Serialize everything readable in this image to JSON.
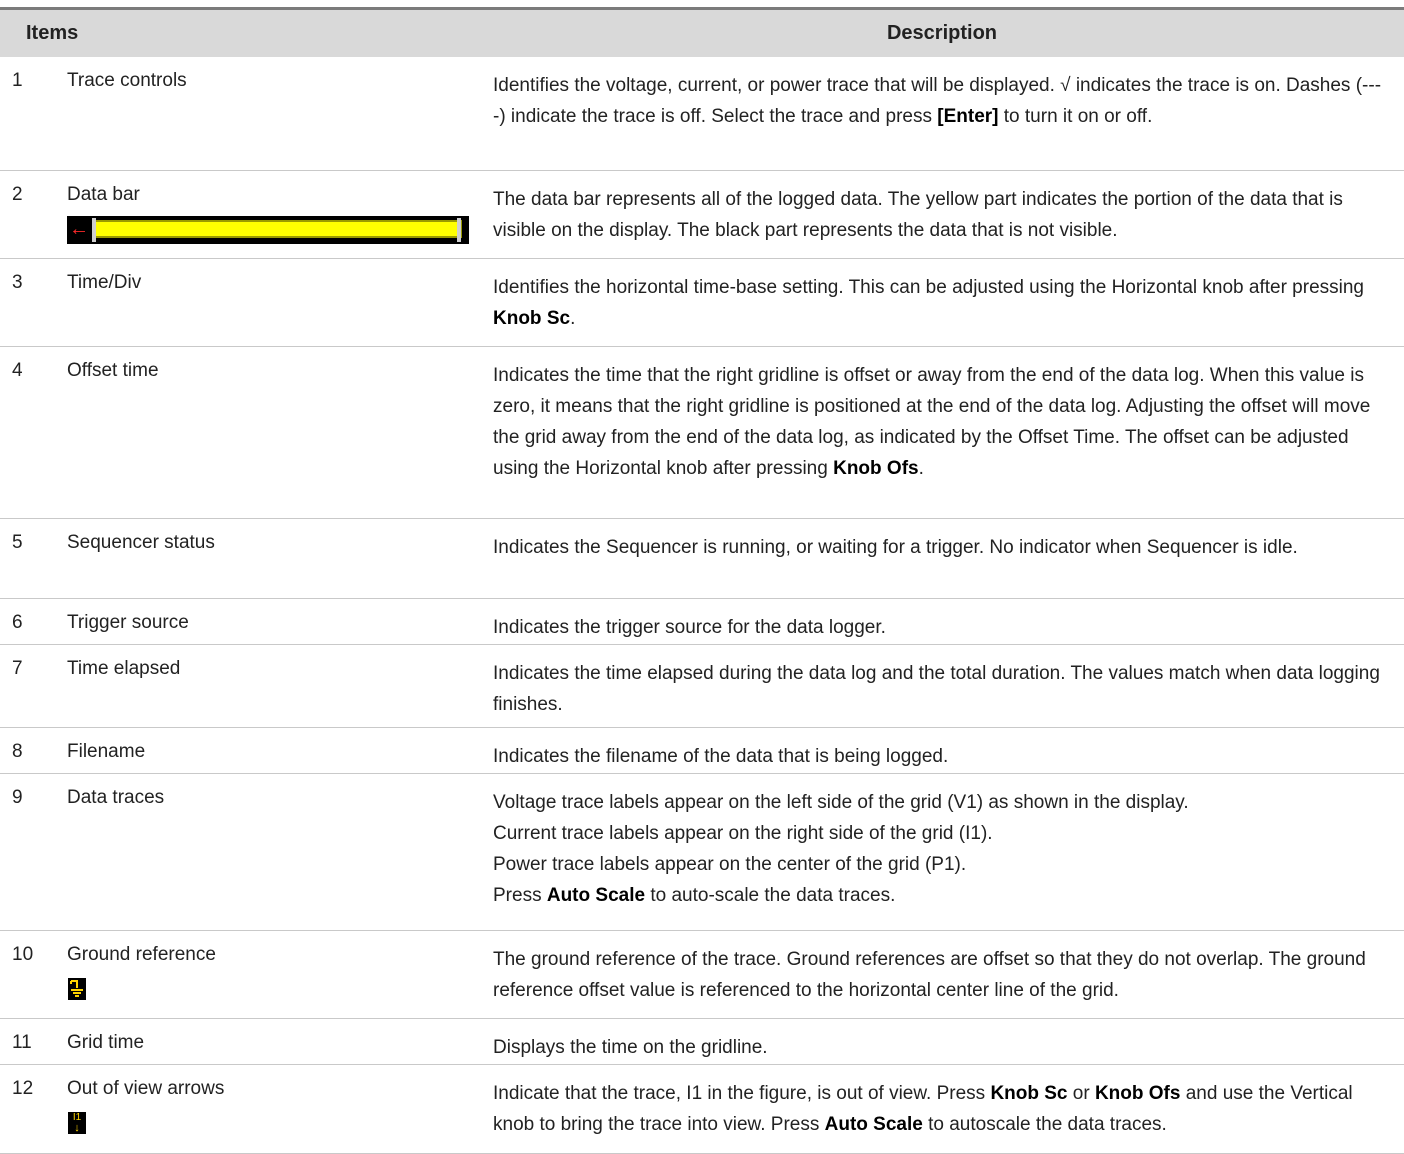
{
  "header": {
    "items": "Items",
    "description": "Description"
  },
  "rows": [
    {
      "num": "1",
      "item": "Trace controls",
      "desc": [
        {
          "t": "Identifies the voltage, current, or power trace that will be displayed. √ indicates the trace is on. Dashes (----) indicate the trace is off. Select the trace and press "
        },
        {
          "k": "[Enter]"
        },
        {
          "t": " to turn it on or off."
        }
      ]
    },
    {
      "num": "2",
      "item": "Data bar",
      "desc": [
        {
          "t": "The data bar represents all of the logged data. The yellow part indicates the portion of the data that is visible on the display. The black part represents the data that is not visible."
        }
      ]
    },
    {
      "num": "3",
      "item": "Time/Div",
      "desc": [
        {
          "t": "Identifies the horizontal time-base setting. This can be adjusted using the Horizontal knob after pressing "
        },
        {
          "k": "Knob Sc"
        },
        {
          "t": "."
        }
      ]
    },
    {
      "num": "4",
      "item": "Offset time",
      "desc": [
        {
          "t": "Indicates the time that the right gridline is offset or away from the end of the data log. When this value is zero, it means that the right gridline is positioned at the end of the data log. Adjusting the offset will move the grid away from the end of the data log, as indicated by the Offset Time. The offset can be adjusted using the Horizontal knob after pressing "
        },
        {
          "k": "Knob Ofs"
        },
        {
          "t": "."
        }
      ]
    },
    {
      "num": "5",
      "item": "Sequencer status",
      "desc": [
        {
          "t": "Indicates the Sequencer is running, or waiting for a trigger. No indicator when Sequencer is idle."
        }
      ]
    },
    {
      "num": "6",
      "item": "Trigger source",
      "desc": [
        {
          "t": "Indicates the trigger source for the data logger."
        }
      ]
    },
    {
      "num": "7",
      "item": "Time elapsed",
      "desc": [
        {
          "t": "Indicates the time elapsed during the data log and the total duration. The values match when data logging finishes."
        }
      ]
    },
    {
      "num": "8",
      "item": "Filename",
      "desc": [
        {
          "t": "Indicates the filename of the data that is being logged."
        }
      ]
    },
    {
      "num": "9",
      "item": "Data traces",
      "lines": [
        [
          {
            "t": "Voltage trace labels appear on the left side of the grid (V1) as shown in the display."
          }
        ],
        [
          {
            "t": "Current trace labels appear on the right side of the grid (I1)."
          }
        ],
        [
          {
            "t": "Power trace labels appear on the center of the grid (P1)."
          }
        ],
        [
          {
            "t": "Press "
          },
          {
            "k": "Auto Scale"
          },
          {
            "t": " to auto-scale the data traces."
          }
        ]
      ]
    },
    {
      "num": "10",
      "item": "Ground reference",
      "desc": [
        {
          "t": "The ground reference of the trace. Ground references are offset so that they do not overlap. The ground reference offset value is referenced to the horizontal center line of the grid."
        }
      ]
    },
    {
      "num": "11",
      "item": "Grid time",
      "desc": [
        {
          "t": "Displays the time on the gridline."
        }
      ]
    },
    {
      "num": "12",
      "item": "Out of view arrows",
      "icon_text": "I1",
      "desc": [
        {
          "t": "Indicate that the trace, I1 in the figure, is out of view. Press "
        },
        {
          "k": "Knob Sc"
        },
        {
          "t": " or "
        },
        {
          "k": "Knob Ofs"
        },
        {
          "t": " and use the Vertical knob to bring the trace into view. Press "
        },
        {
          "k": "Auto Scale"
        },
        {
          "t": " to autoscale the data traces."
        }
      ]
    }
  ],
  "colors": {
    "header_bg": "#d9d9d9",
    "databar_yellow": "#ffff00",
    "databar_black": "#000000",
    "arrow_red": "#ff2a2a"
  }
}
